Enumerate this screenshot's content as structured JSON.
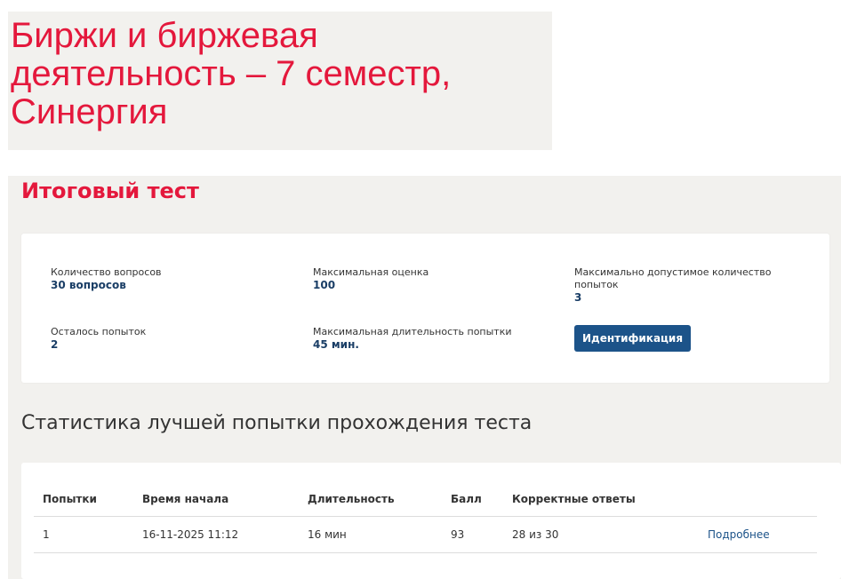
{
  "banner": {
    "title": "Биржи и биржевая деятельность – 7 семестр, Синергия"
  },
  "page": {
    "title": "Итоговый тест"
  },
  "info": {
    "questions_label": "Количество вопросов",
    "questions_value": "30 вопросов",
    "max_score_label": "Максимальная оценка",
    "max_score_value": "100",
    "max_attempts_label": "Максимально допустимое количество попыток",
    "max_attempts_value": "3",
    "attempts_left_label": "Осталось попыток",
    "attempts_left_value": "2",
    "max_duration_label": "Максимальная длительность попытки",
    "max_duration_value": "45 мин.",
    "identify_button": "Идентификация"
  },
  "stats": {
    "title": "Статистика лучшей попытки прохождения теста",
    "columns": [
      "Попытки",
      "Время начала",
      "Длительность",
      "Балл",
      "Корректные ответы",
      ""
    ],
    "rows": [
      {
        "attempt": "1",
        "start_time": "16-11-2025 11:12",
        "duration": "16 мин",
        "score": "93",
        "correct": "28 из 30",
        "details_link": "Подробнее"
      }
    ]
  },
  "colors": {
    "accent_red": "#e4183c",
    "primary_blue": "#1c5389",
    "value_blue": "#1a3e66",
    "panel_bg": "#f2f1ee"
  }
}
